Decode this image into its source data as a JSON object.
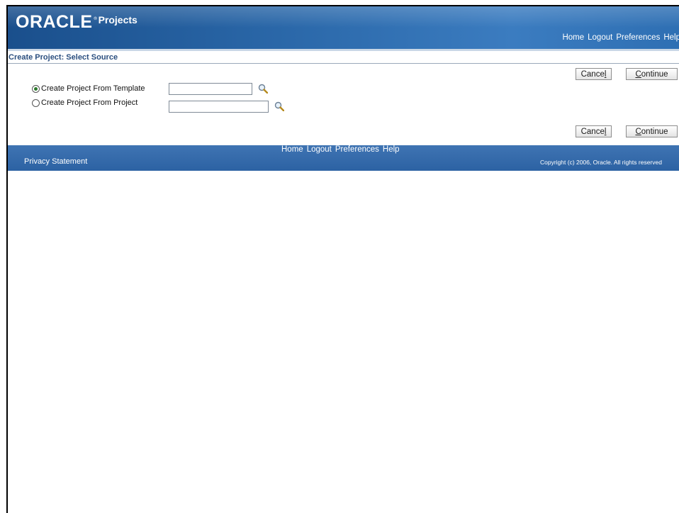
{
  "header": {
    "logo_text": "ORACLE",
    "logo_mark": "®",
    "product_name": "Projects",
    "global_links": [
      "Home",
      "Logout",
      "Preferences",
      "Help"
    ]
  },
  "page_title": "Create Project: Select Source",
  "buttons": {
    "cancel_first": "Cance",
    "cancel_access_key": "l",
    "continue_access_key": "C",
    "continue_rest": "ontinue"
  },
  "form": {
    "options": [
      {
        "label": "Create Project From Template",
        "selected": true,
        "value": ""
      },
      {
        "label": "Create Project From Project",
        "selected": false,
        "value": ""
      }
    ]
  },
  "footer": {
    "links": [
      "Home",
      "Logout",
      "Preferences",
      "Help"
    ],
    "privacy": "Privacy Statement",
    "copyright": "Copyright (c) 2006, Oracle. All rights reserved"
  },
  "colors": {
    "brand_blue": "#2a67a8",
    "title_blue": "#2b4f7f"
  },
  "icons": {
    "search": "magnifying-glass-icon"
  }
}
